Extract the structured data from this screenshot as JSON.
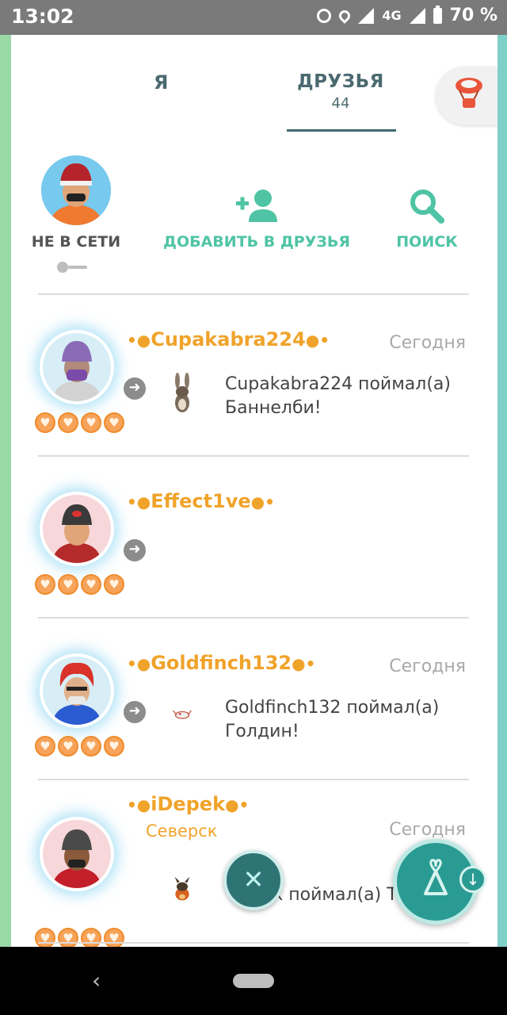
{
  "status_bar": {
    "time": "13:02",
    "network": "4G",
    "battery": "70 %",
    "icons": [
      "alarm-icon",
      "location-icon",
      "signal-icon",
      "signal-icon",
      "battery-icon"
    ]
  },
  "tabs": {
    "me": "Я",
    "friends": "ДРУЗЬЯ",
    "friends_count": "44"
  },
  "me": {
    "status": "НЕ В СЕТИ",
    "avatar": "player-avatar"
  },
  "actions": {
    "add_friend": "ДОБАВИТЬ В ДРУЗЬЯ",
    "search": "ПОИСК"
  },
  "friends": [
    {
      "name": "Cupakabra224",
      "date": "Сегодня",
      "message": "Cupakabra224 поймал(а) Баннелби!",
      "hearts": 4
    },
    {
      "name": "Effect1ve",
      "date": "",
      "message": "",
      "hearts": 4
    },
    {
      "name": "Goldfinch132",
      "date": "Сегодня",
      "message": "Goldfinch132 поймал(а) Голдин!",
      "hearts": 4
    },
    {
      "name": "iDepek",
      "place": "Северск",
      "date": "Сегодня",
      "message": "к поймал(а) Т",
      "hearts": 4
    }
  ],
  "colors": {
    "accent": "#4fc4a5",
    "friend_name": "#f0a32a",
    "tab_text": "#4b6a70"
  }
}
